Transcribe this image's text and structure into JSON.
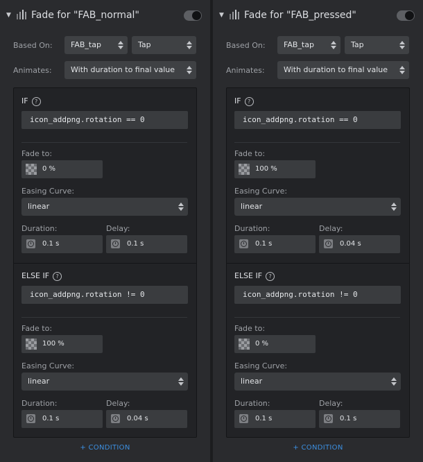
{
  "panels": [
    {
      "title": "Fade for \"FAB_normal\"",
      "based_on_label": "Based On:",
      "based_on_layer": "FAB_tap",
      "based_on_event": "Tap",
      "animates_label": "Animates:",
      "animates_value": "With duration to final value",
      "conditions": [
        {
          "keyword": "IF",
          "expression": "icon_addpng.rotation == 0",
          "fade_to_label": "Fade to:",
          "fade_to_value": "0 %",
          "easing_label": "Easing Curve:",
          "easing_value": "linear",
          "duration_label": "Duration:",
          "duration_value": "0.1 s",
          "delay_label": "Delay:",
          "delay_value": "0.1 s"
        },
        {
          "keyword": "ELSE IF",
          "expression": "icon_addpng.rotation != 0",
          "fade_to_label": "Fade to:",
          "fade_to_value": "100 %",
          "easing_label": "Easing Curve:",
          "easing_value": "linear",
          "duration_label": "Duration:",
          "duration_value": "0.1 s",
          "delay_label": "Delay:",
          "delay_value": "0.04 s"
        }
      ],
      "add_condition_label": "+ CONDITION"
    },
    {
      "title": "Fade for \"FAB_pressed\"",
      "based_on_label": "Based On:",
      "based_on_layer": "FAB_tap",
      "based_on_event": "Tap",
      "animates_label": "Animates:",
      "animates_value": "With duration to final value",
      "conditions": [
        {
          "keyword": "IF",
          "expression": "icon_addpng.rotation == 0",
          "fade_to_label": "Fade to:",
          "fade_to_value": "100 %",
          "easing_label": "Easing Curve:",
          "easing_value": "linear",
          "duration_label": "Duration:",
          "duration_value": "0.1 s",
          "delay_label": "Delay:",
          "delay_value": "0.04 s"
        },
        {
          "keyword": "ELSE IF",
          "expression": "icon_addpng.rotation != 0",
          "fade_to_label": "Fade to:",
          "fade_to_value": "0 %",
          "easing_label": "Easing Curve:",
          "easing_value": "linear",
          "duration_label": "Duration:",
          "duration_value": "0.1 s",
          "delay_label": "Delay:",
          "delay_value": "0.1 s"
        }
      ],
      "add_condition_label": "+ CONDITION"
    }
  ],
  "help_glyph": "?",
  "collapse_glyph": "▼",
  "colors": {
    "accent": "#3c8fe0",
    "panel_bg": "#2a2b2e",
    "field_bg": "#3a3c3f"
  },
  "icons": [
    "collapse-chevron-icon",
    "fade-bars-icon",
    "toggle-switch",
    "help-icon",
    "opacity-checker-icon",
    "clock-icon",
    "select-arrows-icon"
  ]
}
